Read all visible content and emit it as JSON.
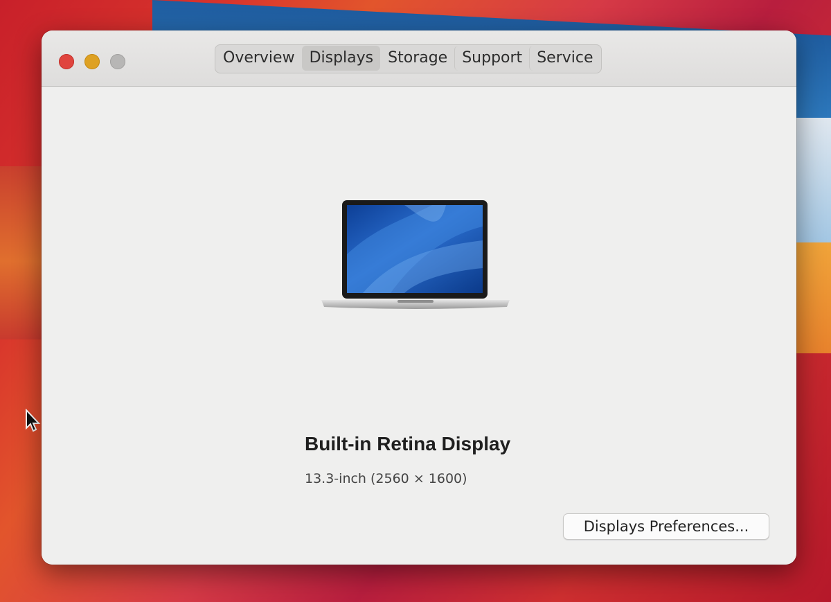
{
  "window": {
    "controls": [
      "close-button",
      "minimize-button",
      "zoom-button"
    ]
  },
  "tabs": [
    {
      "label": "Overview",
      "selected": false
    },
    {
      "label": "Displays",
      "selected": true
    },
    {
      "label": "Storage",
      "selected": false
    },
    {
      "label": "Support",
      "selected": false
    },
    {
      "label": "Service",
      "selected": false
    }
  ],
  "display": {
    "name": "Built-in Retina Display",
    "spec": "13.3-inch (2560 × 1600)",
    "image_icon": "macbook-pro-icon"
  },
  "button": {
    "label": "Displays Preferences..."
  },
  "colors": {
    "close": "#e0443e",
    "minimize": "#dea123",
    "zoom": "#b7b6b5",
    "window_bg": "#efefee"
  }
}
